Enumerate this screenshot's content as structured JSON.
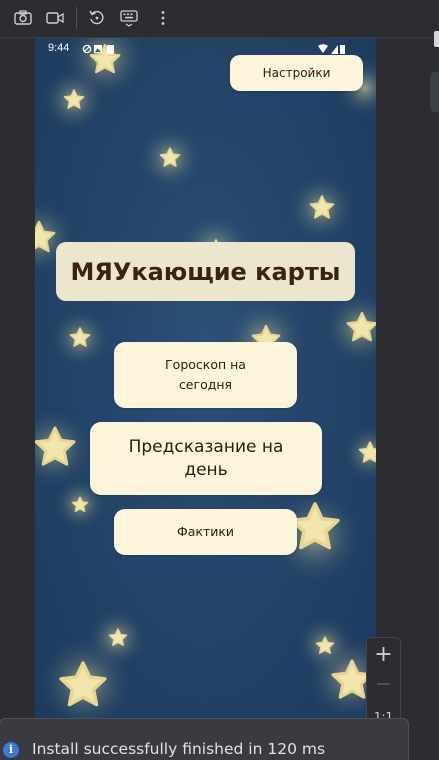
{
  "toolbar": {
    "icons": [
      "camera-icon",
      "video-icon",
      "rotate-icon",
      "keyboard-icon",
      "more-vertical-icon"
    ]
  },
  "phone": {
    "status_time": "9:44",
    "background_color": "#244569",
    "button_color": "#fdf5d9",
    "settings_label": "Настройки",
    "app_title": "МЯУкающие карты",
    "horoscope_label": "Гороскоп на сегодня",
    "prediction_label": "Предсказание на день",
    "facts_label": "Фактики"
  },
  "zoom": {
    "zoom_in": "+",
    "zoom_out": "—",
    "reset": "1:1"
  },
  "notification": {
    "icon": "info-icon",
    "text": "Install successfully finished in 120 ms"
  }
}
